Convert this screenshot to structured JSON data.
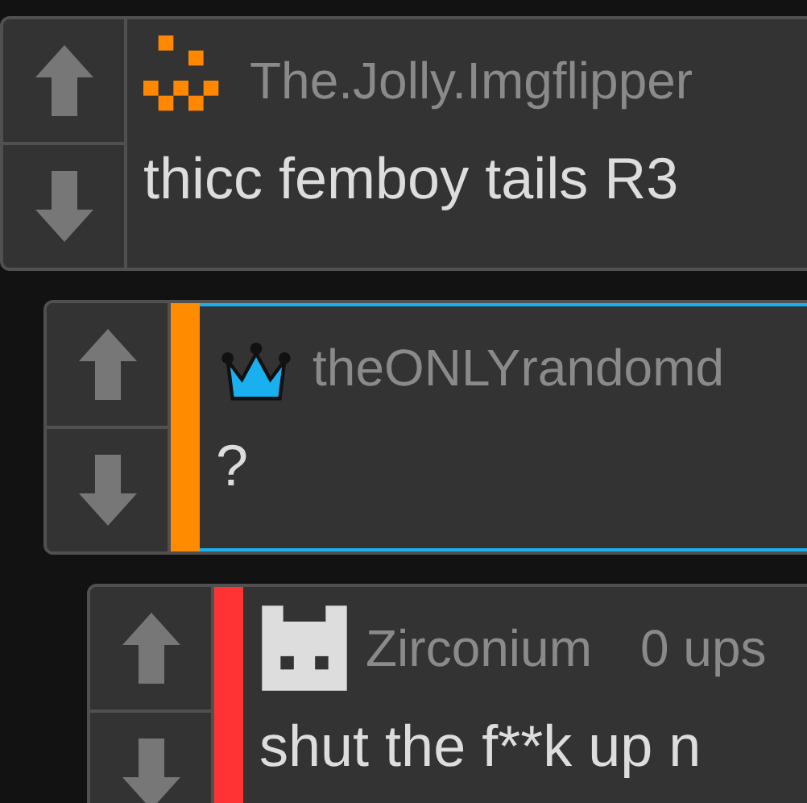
{
  "comments": [
    {
      "username": "The.Jolly.Imgflipper",
      "kind": "pixel-smile",
      "text": "thicc femboy tails R3",
      "children": [
        {
          "username": "theONLYrandomd",
          "kind": "crown",
          "color": "#ff8c00",
          "highlighted": true,
          "text": "?",
          "children": [
            {
              "username": "Zirconium",
              "points": "0 ups",
              "kind": "castle",
              "color": "#ff3333",
              "highlighted": false,
              "text": "shut the f**k up n"
            }
          ]
        }
      ]
    }
  ]
}
